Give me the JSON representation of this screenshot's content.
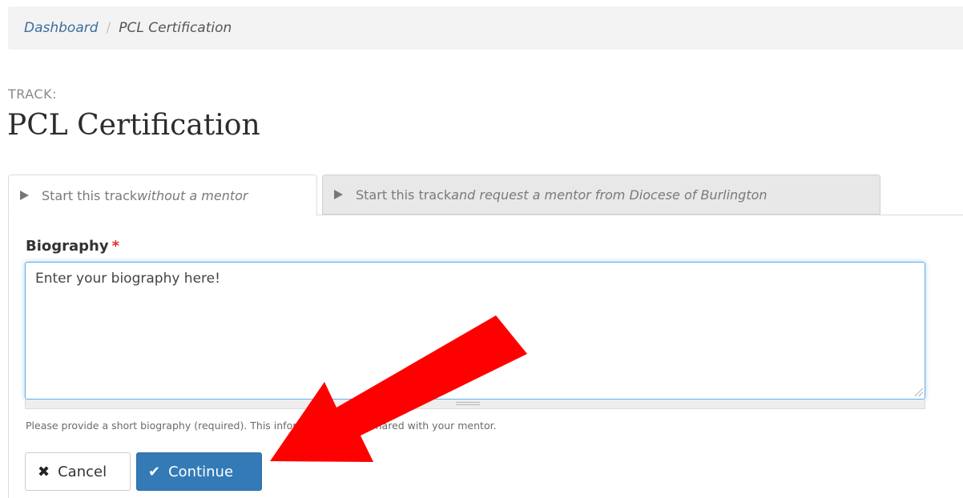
{
  "breadcrumb": {
    "home_label": "Dashboard",
    "separator": "/",
    "current_label": "PCL Certification"
  },
  "header": {
    "track_label": "TRACK:",
    "title": "PCL Certification"
  },
  "tabs": [
    {
      "prefix": "Start this track ",
      "emphasis": "without a mentor",
      "active": true
    },
    {
      "prefix": "Start this track ",
      "emphasis": "and request a mentor from Diocese of Burlington",
      "active": false
    }
  ],
  "form": {
    "biography_label": "Biography",
    "required_marker": "*",
    "biography_value": "Enter your biography here!",
    "help_text": "Please provide a short biography (required). This information will be shared with your mentor."
  },
  "buttons": {
    "cancel_label": "Cancel",
    "cancel_icon": "✖",
    "continue_label": "Continue",
    "continue_icon": "✔"
  },
  "colors": {
    "link": "#3c6e9e",
    "primary_button": "#337ab7",
    "required": "#d9302c",
    "annotation_arrow": "#ff0000"
  },
  "icons": {
    "tab_icon": "play-triangle-icon",
    "cancel_icon": "x-icon",
    "continue_icon": "checkmark-icon",
    "annotation": "red-arrow-icon"
  }
}
